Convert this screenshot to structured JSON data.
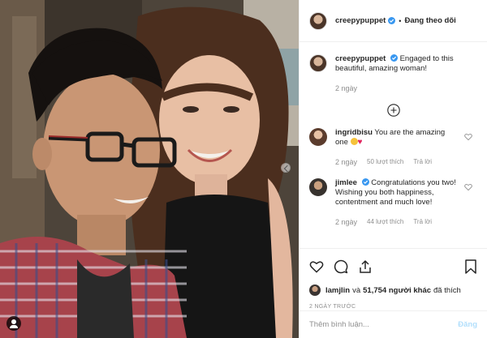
{
  "post": {
    "author": "creepypuppet",
    "follow_status": "Đang theo dõi",
    "caption": "Engaged to this beautiful, amazing woman!",
    "caption_age": "2 ngày"
  },
  "comments": [
    {
      "user": "ingridbisu",
      "text": "You are the amazing one",
      "age": "2 ngày",
      "likes": "50 lượt thích",
      "reply": "Trả lời"
    },
    {
      "user": "jimlee",
      "text": "Congratulations you two! Wishing you both happiness, contentment and much love!",
      "age": "2 ngày",
      "likes": "44 lượt thích",
      "reply": "Trả lời"
    }
  ],
  "likes_line": {
    "first_user": "lamjlin",
    "connector": "và",
    "others": "51,754 người khác",
    "suffix": "đã thích"
  },
  "timestamp": "2 NGÀY TRƯỚC",
  "comment_box": {
    "placeholder": "Thêm bình luận...",
    "post_label": "Đăng"
  },
  "icons": {
    "verified": "verified-badge-icon",
    "heart": "heart-icon",
    "comment": "comment-icon",
    "share": "share-icon",
    "bookmark": "bookmark-icon",
    "add": "plus-circle-icon",
    "tag": "user-tag-icon"
  },
  "colors": {
    "verified_blue": "#3897f0",
    "muted": "#8e8e8e",
    "post_button_disabled": "#b2dffc"
  }
}
